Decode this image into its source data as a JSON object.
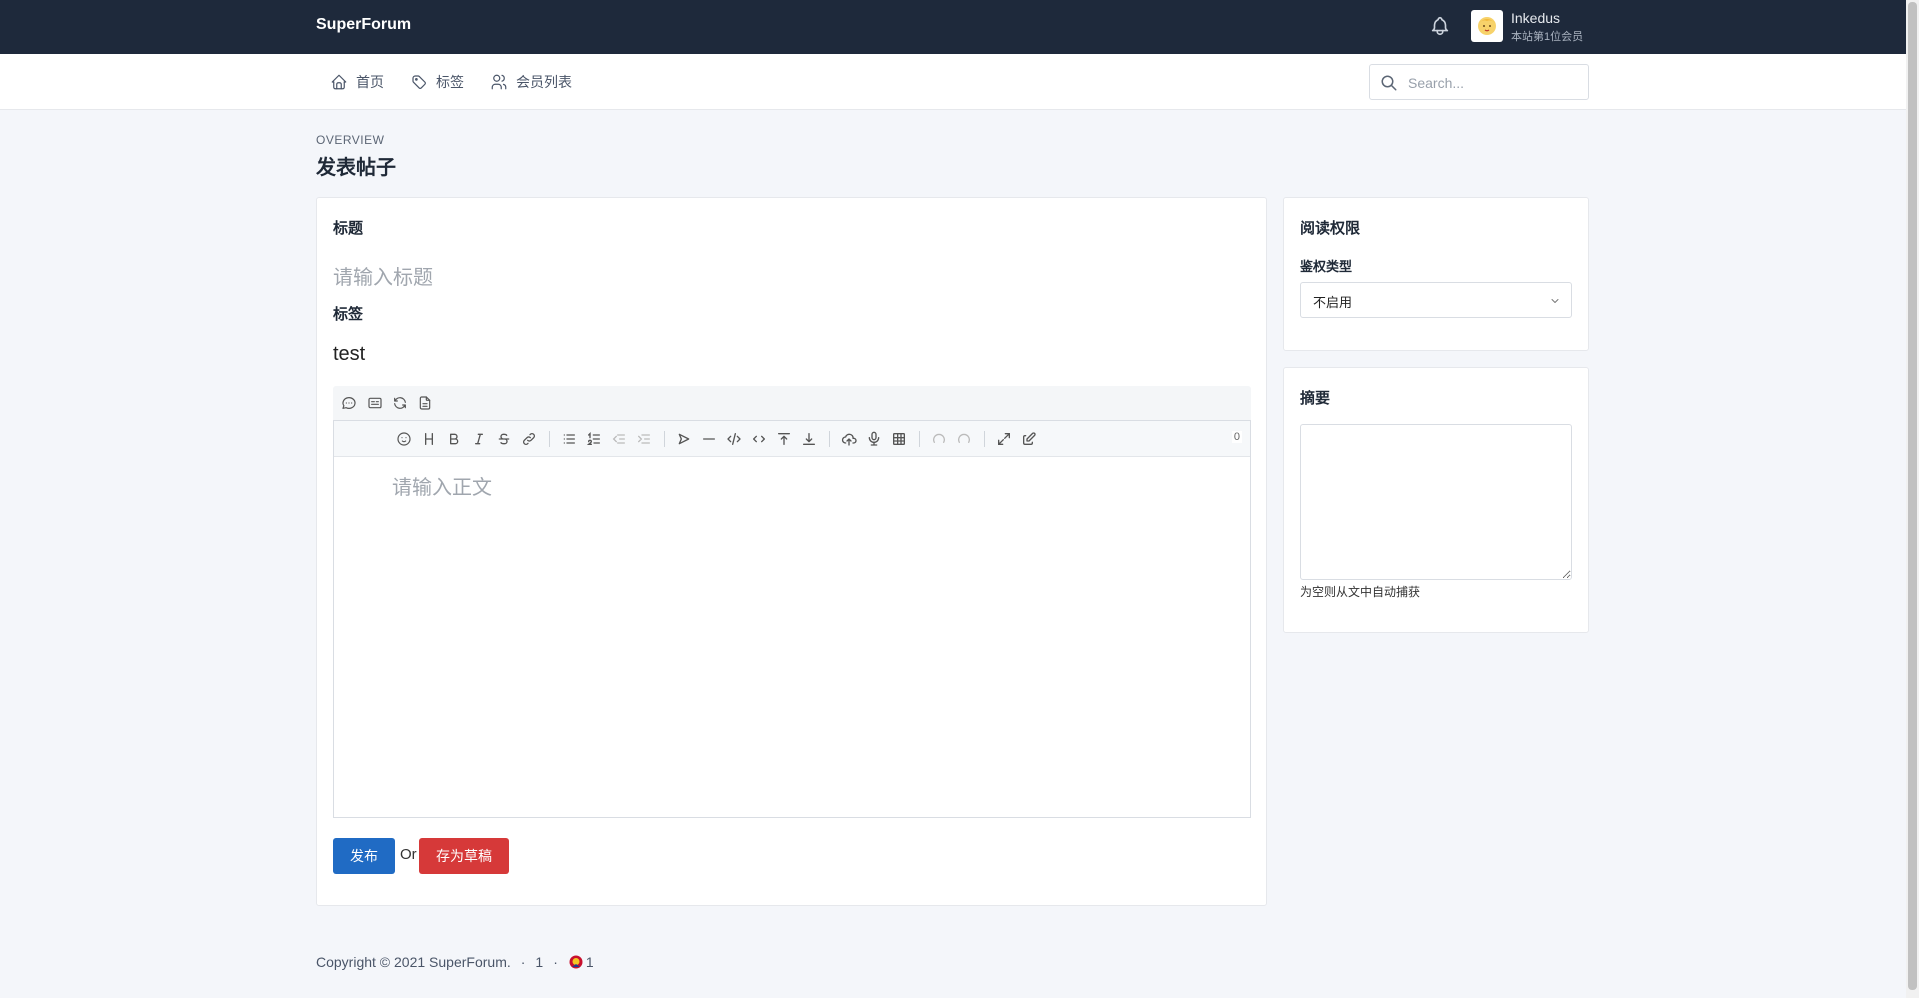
{
  "header": {
    "brand": "SuperForum",
    "user": {
      "name": "Inkedus",
      "subtitle": "本站第1位会员"
    }
  },
  "nav": {
    "items": [
      {
        "label": "首页",
        "icon": "home-icon"
      },
      {
        "label": "标签",
        "icon": "tag-icon"
      },
      {
        "label": "会员列表",
        "icon": "users-icon"
      }
    ],
    "search_placeholder": "Search..."
  },
  "page": {
    "pretitle": "OVERVIEW",
    "title": "发表帖子"
  },
  "form": {
    "title_label": "标题",
    "title_placeholder": "请输入标题",
    "tag_label": "标签",
    "tag_value": "test",
    "editor_placeholder": "请输入正文",
    "char_count": "0",
    "publish_label": "发布",
    "or_text": "Or",
    "draft_label": "存为草稿"
  },
  "sidebar": {
    "permission_title": "阅读权限",
    "auth_type_label": "鉴权类型",
    "auth_type_value": "不启用",
    "summary_title": "摘要",
    "summary_hint": "为空则从文中自动捕获"
  },
  "footer": {
    "copyright": "Copyright © 2021 SuperForum.",
    "count_a": "1",
    "count_b": "1"
  },
  "colors": {
    "topbar": "#1e293b",
    "primary": "#206bc4",
    "danger": "#d63939"
  }
}
